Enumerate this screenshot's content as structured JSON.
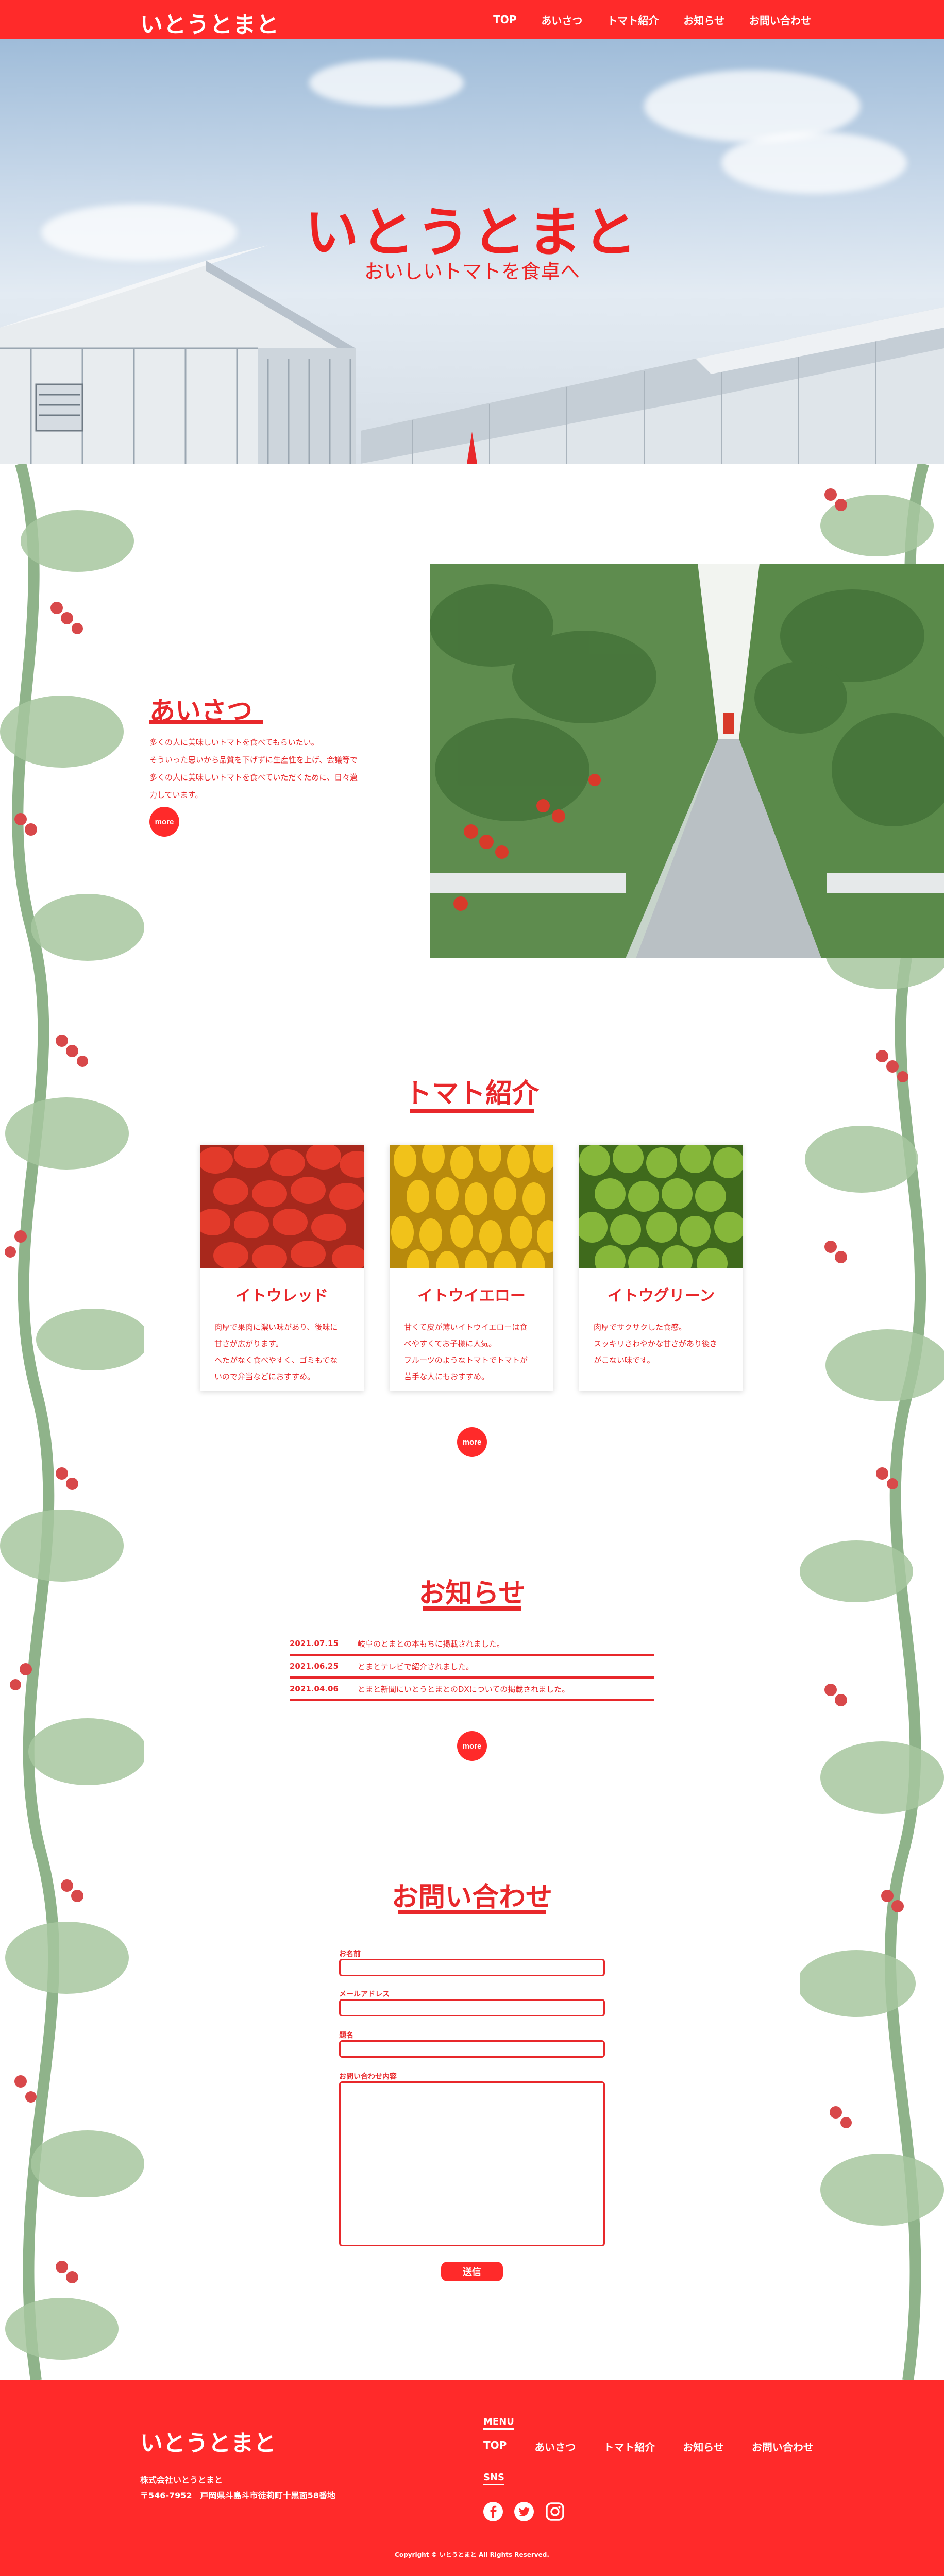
{
  "brand": {
    "logo": "いとうとまと",
    "accent": "#ff2a2a"
  },
  "nav": {
    "items": [
      "TOP",
      "あいさつ",
      "トマト紹介",
      "お知らせ",
      "お問い合わせ"
    ]
  },
  "hero": {
    "title": "いとうとまと",
    "subtitle": "おいしいトマトを食卓へ"
  },
  "greeting": {
    "title": "あいさつ",
    "lines": [
      "多くの人に美味しいトマトを食べてもらいたい。",
      "そういった思いから品質を下げずに生産性を上げ、会議等で",
      "多くの人に美味しいトマトを食べていただくために、日々邁",
      "力しています。"
    ],
    "more": "more"
  },
  "tomatoes": {
    "title": "トマト紹介",
    "cards": [
      {
        "name": "イトウレッド",
        "lines": [
          "肉厚で果肉に濃い味があり、後味に",
          "甘さが広がります。",
          "へたがなく食べやすく、ゴミもでな",
          "いので弁当などにおすすめ。"
        ]
      },
      {
        "name": "イトウイエロー",
        "lines": [
          "甘くて皮が薄いイトウイエローは食",
          "べやすくてお子様に人気。",
          "フルーツのようなトマトでトマトが",
          "苦手な人にもおすすめ。"
        ]
      },
      {
        "name": "イトウグリーン",
        "lines": [
          "肉厚でサクサクした食感。",
          "スッキリさわやかな甘さがあり後き",
          "がこない味です。"
        ]
      }
    ],
    "more": "more"
  },
  "news": {
    "title": "お知らせ",
    "items": [
      {
        "date": "2021.07.15",
        "text": "岐阜のとまとの本もちに掲載されました。"
      },
      {
        "date": "2021.06.25",
        "text": "とまとテレビで紹介されました。"
      },
      {
        "date": "2021.04.06",
        "text": "とまと新聞にいとうとまとのDXについての掲載されました。"
      }
    ],
    "more": "more"
  },
  "contact": {
    "title": "お問い合わせ",
    "fields": {
      "name": "お名前",
      "email": "メールアドレス",
      "subject": "題名",
      "message": "お問い合わせ内容"
    },
    "submit": "送信"
  },
  "footer": {
    "logo": "いとうとまと",
    "company": "株式会社いとうとまと",
    "address": "〒546-7952　戸岡県斗島斗市徒莉町十黒面58番地",
    "menu_label": "MENU",
    "sns_label": "SNS",
    "sns": [
      "facebook-icon",
      "twitter-icon",
      "instagram-icon"
    ],
    "copyright": "Copyright © いとうとまと All Rights Reserved."
  }
}
